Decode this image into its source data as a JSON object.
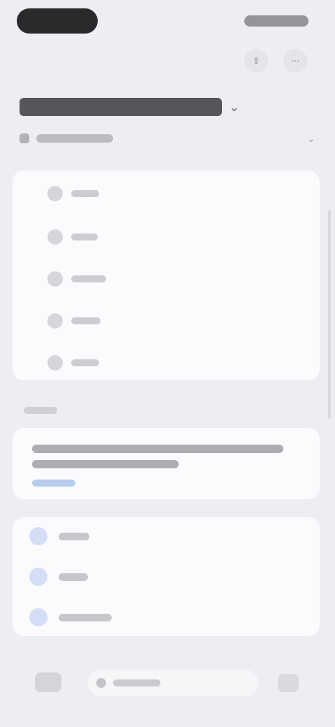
{
  "status_bar": {},
  "top_actions": [
    {
      "icon": "share-icon",
      "glyph": "⇪"
    },
    {
      "icon": "more-icon",
      "glyph": "⋯"
    }
  ],
  "header": {
    "title": "",
    "filter_label": ""
  },
  "list": {
    "items": [
      {
        "icon": "item-icon",
        "label": ""
      },
      {
        "icon": "item-icon",
        "label": ""
      },
      {
        "icon": "item-icon",
        "label": ""
      },
      {
        "icon": "item-icon",
        "label": ""
      },
      {
        "icon": "item-icon",
        "label": ""
      }
    ]
  },
  "note": {
    "section_label": "",
    "text": "",
    "link": ""
  },
  "actions": [
    {
      "icon": "action-icon",
      "label": ""
    },
    {
      "icon": "action-icon",
      "label": ""
    },
    {
      "icon": "action-icon",
      "label": ""
    }
  ],
  "bottom_bar": {
    "input_placeholder": ""
  },
  "colors": {
    "background": "#eeeef2",
    "card": "#fbfbfd",
    "accent": "#7ea7e6"
  }
}
